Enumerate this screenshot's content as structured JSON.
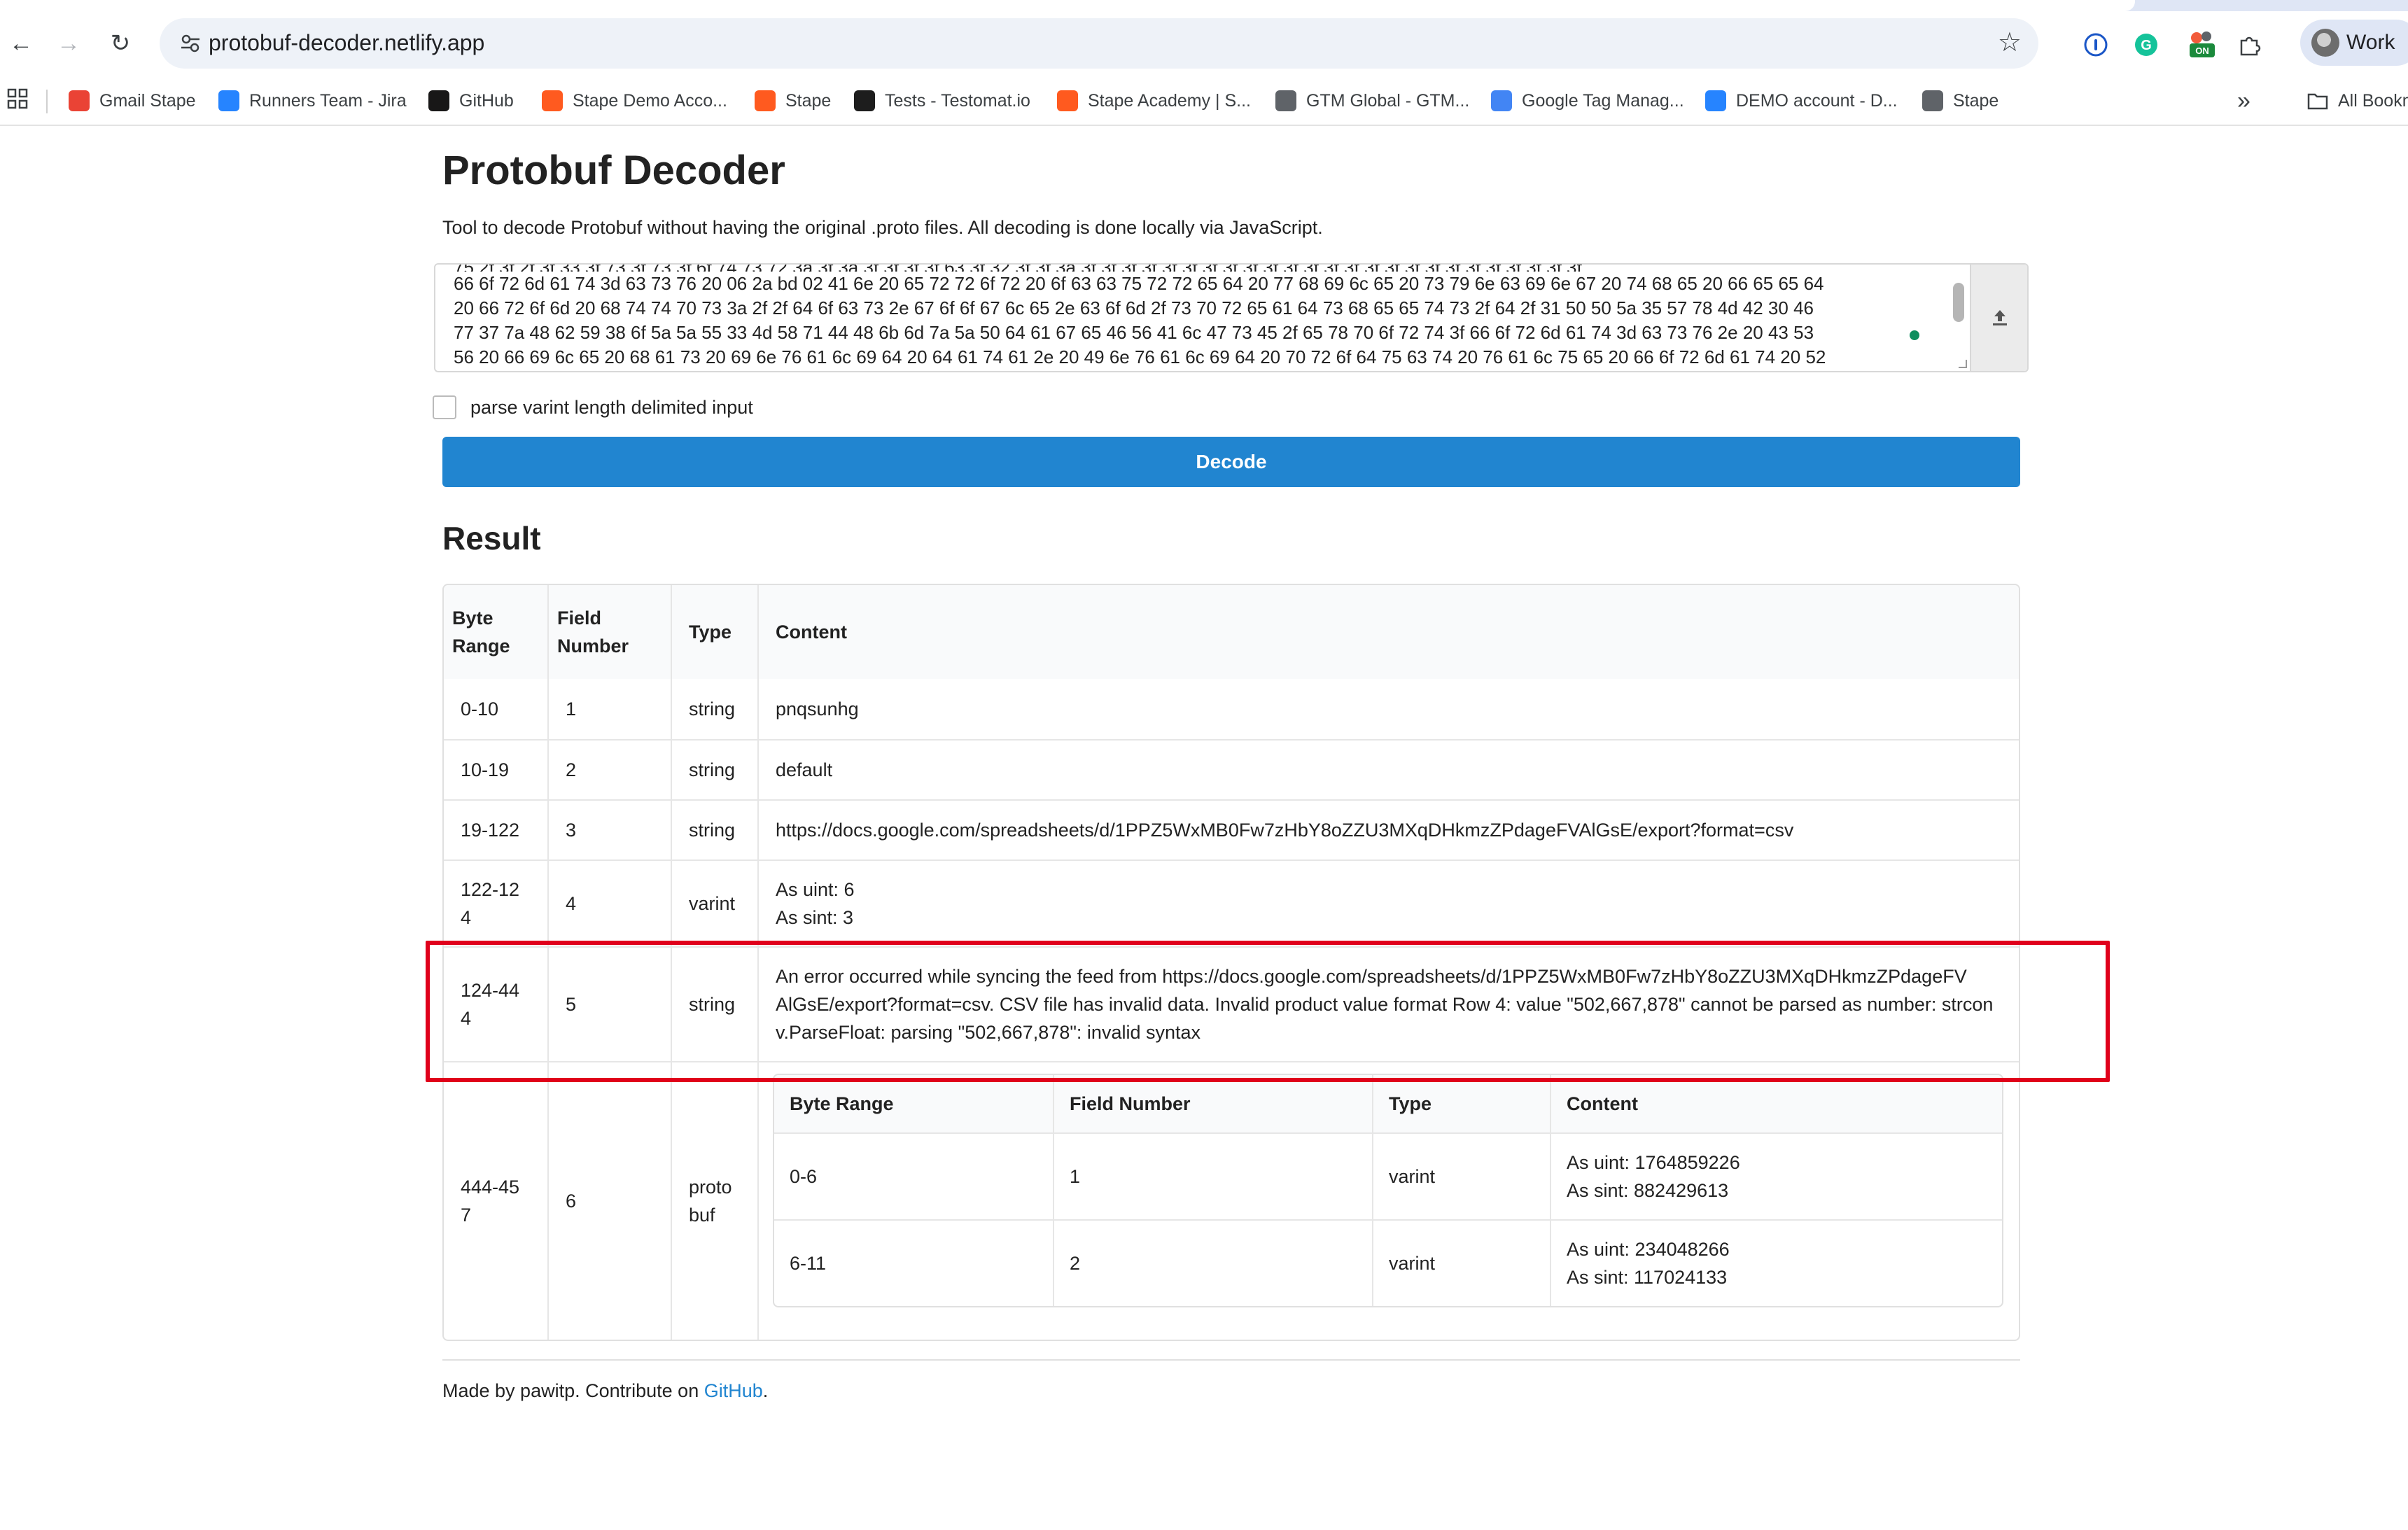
{
  "browser": {
    "url": "protobuf-decoder.netlify.app",
    "profile_label": "Work",
    "bookmarks": [
      {
        "label": "Gmail Stape",
        "icon": "gmail-icon",
        "color": "#ea4335"
      },
      {
        "label": "Runners Team - Jira",
        "icon": "jira-icon",
        "color": "#2684ff"
      },
      {
        "label": "GitHub",
        "icon": "github-icon",
        "color": "#181717"
      },
      {
        "label": "Stape Demo Acco...",
        "icon": "stape-icon",
        "color": "#ff5a1f"
      },
      {
        "label": "Stape",
        "icon": "stape-icon",
        "color": "#ff5a1f"
      },
      {
        "label": "Tests - Testomat.io",
        "icon": "testomat-icon",
        "color": "#1d1d1d"
      },
      {
        "label": "Stape Academy | S...",
        "icon": "stape-icon",
        "color": "#ff5a1f"
      },
      {
        "label": "GTM Global - GTM...",
        "icon": "globe-icon",
        "color": "#5f6368"
      },
      {
        "label": "Google Tag Manag...",
        "icon": "gtm-icon",
        "color": "#4285f4"
      },
      {
        "label": "DEMO account - D...",
        "icon": "confluence-icon",
        "color": "#2684ff"
      },
      {
        "label": "Stape",
        "icon": "globe-icon",
        "color": "#5f6368"
      }
    ],
    "all_bookmarks_label": "All Bookm"
  },
  "page": {
    "title": "Protobuf Decoder",
    "description": "Tool to decode Protobuf without having the original .proto files. All decoding is done locally via JavaScript.",
    "input_hex_lines": [
      "66 6f 72 6d 61 74 3d 63 73 76 20 06 2a bd 02 41 6e 20 65 72 72 6f 72 20 6f 63 63 75 72 72 65 64 20 77 68 69 6c 65 20 73 79 6e 63 69 6e 67 20 74 68 65 20 66 65 65 64",
      "20 66 72 6f 6d 20 68 74 74 70 73 3a 2f 2f 64 6f 63 73 2e 67 6f 6f 67 6c 65 2e 63 6f 6d 2f 73 70 72 65 61 64 73 68 65 65 74 73 2f 64 2f 31 50 50 5a 35 57 78 4d 42 30 46",
      "77 37 7a 48 62 59 38 6f 5a 5a 55 33 4d 58 71 44 48 6b 6d 7a 5a 50 64 61 67 65 46 56 41 6c 47 73 45 2f 65 78 70 6f 72 74 3f 66 6f 72 6d 61 74 3d 63 73 76 2e 20 43 53",
      "56 20 66 69 6c 65 20 68 61 73 20 69 6e 76 61 6c 69 64 20 64 61 74 61 2e 20 49 6e 76 61 6c 69 64 20 70 72 6f 64 75 63 74 20 76 61 6c 75 65 20 66 6f 72 6d 61 74 20 52"
    ],
    "checkbox_label": "parse varint length delimited input",
    "decode_label": "Decode",
    "result_heading": "Result",
    "columns": [
      "Byte Range",
      "Field Number",
      "Type",
      "Content"
    ],
    "header_wrapped": {
      "byte": [
        "Byte",
        "Range"
      ],
      "field": [
        "Field",
        "Number"
      ]
    },
    "rows": [
      {
        "range": [
          "0-10"
        ],
        "field": "1",
        "type": [
          "string"
        ],
        "content": [
          "pnqsunhg"
        ]
      },
      {
        "range": [
          "10-19"
        ],
        "field": "2",
        "type": [
          "string"
        ],
        "content": [
          "default"
        ]
      },
      {
        "range": [
          "19-122"
        ],
        "field": "3",
        "type": [
          "string"
        ],
        "content": [
          "https://docs.google.com/spreadsheets/d/1PPZ5WxMB0Fw7zHbY8oZZU3MXqDHkmzZPdageFVAlGsE/export?format=csv"
        ]
      },
      {
        "range": [
          "122-12",
          "4"
        ],
        "field": "4",
        "type": [
          "varint"
        ],
        "content": [
          "As uint: 6",
          "As sint: 3"
        ]
      },
      {
        "range": [
          "124-44",
          "4"
        ],
        "field": "5",
        "type": [
          "string"
        ],
        "content": [
          "An error occurred while syncing the feed from https://docs.google.com/spreadsheets/d/1PPZ5WxMB0Fw7zHbY8oZZU3MXqDHkmzZPdageFV",
          "AlGsE/export?format=csv. CSV file has invalid data. Invalid product value format Row 4: value \"502,667,878\" cannot be parsed as number: strcon",
          "v.ParseFloat: parsing \"502,667,878\": invalid syntax"
        ]
      },
      {
        "range": [
          "444-45",
          "7"
        ],
        "field": "6",
        "type": [
          "proto",
          "buf"
        ],
        "nested": true
      }
    ],
    "nested_rows": [
      {
        "range": "0-6",
        "field": "1",
        "type": "varint",
        "content": [
          "As uint: 1764859226",
          "As sint: 882429613"
        ]
      },
      {
        "range": "6-11",
        "field": "2",
        "type": "varint",
        "content": [
          "As uint: 234048266",
          "As sint: 117024133"
        ]
      }
    ],
    "footer": {
      "prefix": "Made by pawitp. Contribute on ",
      "link": "GitHub",
      "suffix": "."
    },
    "highlight_color": "#e0001b"
  }
}
